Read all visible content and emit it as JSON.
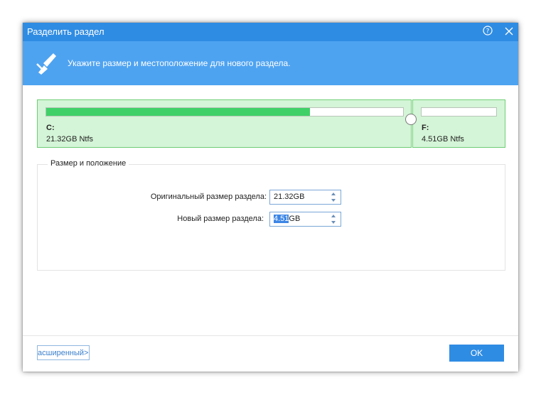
{
  "window": {
    "title": "Разделить раздел",
    "help_icon": "help-icon",
    "close_icon": "close-icon"
  },
  "header": {
    "icon": "split-knife-icon",
    "text": "Укажите размер и местоположение для нового раздела."
  },
  "partitions": [
    {
      "letter": "C:",
      "info": "21.32GB Ntfs",
      "used_fraction": 0.74
    },
    {
      "letter": "F:",
      "info": "4.51GB Ntfs",
      "used_fraction": 0.0
    }
  ],
  "size_group": {
    "title": "Размер и положение",
    "original_label": "Оригинальный размер раздела:",
    "original_value": "21.32GB",
    "new_label": "Новый размер раздела:",
    "new_value_selected": "4.51",
    "new_value_unit": "GB"
  },
  "footer": {
    "advanced_label": "асширенный>>",
    "ok_label": "OK"
  },
  "colors": {
    "titlebar": "#2f8ce3",
    "header_band": "#4ea3f1",
    "partition_bg": "#d4f5d7",
    "usage_fill": "#3fd167",
    "ok_button": "#2f8ce3"
  }
}
